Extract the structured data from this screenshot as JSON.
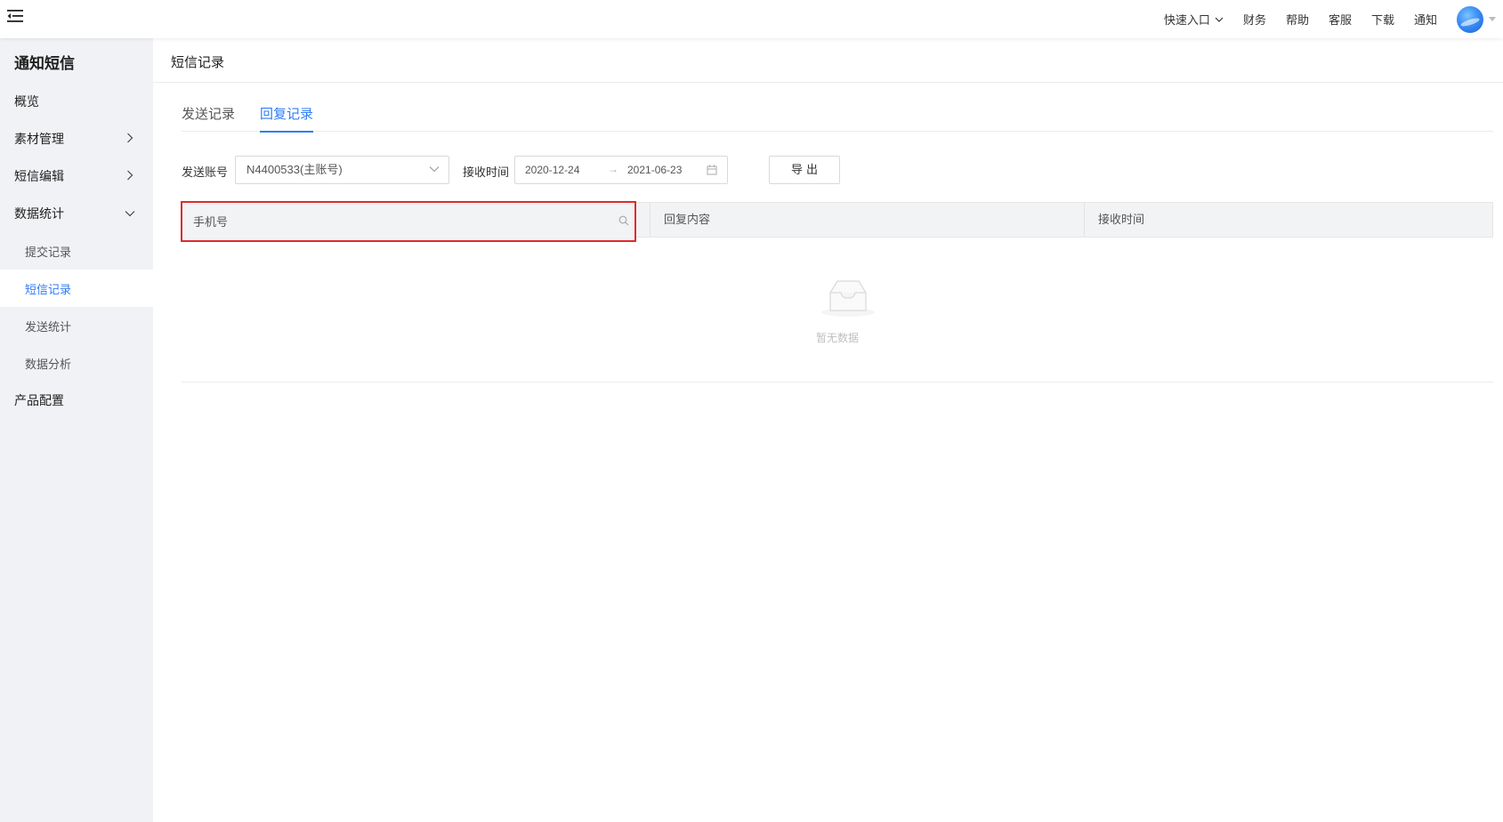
{
  "header": {
    "nav": [
      {
        "label": "快速入口",
        "has_dropdown": true
      },
      {
        "label": "财务"
      },
      {
        "label": "帮助"
      },
      {
        "label": "客服"
      },
      {
        "label": "下载"
      },
      {
        "label": "通知"
      }
    ]
  },
  "sidebar": {
    "title": "通知短信",
    "items": [
      {
        "label": "概览"
      },
      {
        "label": "素材管理",
        "arrow": "right"
      },
      {
        "label": "短信编辑",
        "arrow": "right"
      },
      {
        "label": "数据统计",
        "arrow": "down",
        "expanded": true,
        "children": [
          {
            "label": "提交记录"
          },
          {
            "label": "短信记录",
            "active": true
          },
          {
            "label": "发送统计"
          },
          {
            "label": "数据分析"
          }
        ]
      },
      {
        "label": "产品配置"
      }
    ]
  },
  "main": {
    "page_title": "短信记录",
    "tabs": [
      {
        "label": "发送记录"
      },
      {
        "label": "回复记录",
        "active": true
      }
    ],
    "filters": {
      "account_label": "发送账号",
      "account_value": "N4400533(主账号)",
      "time_label": "接收时间",
      "date_start": "2020-12-24",
      "date_sep": "→",
      "date_end": "2021-06-23",
      "export_label": "导出"
    },
    "table": {
      "phone_placeholder": "手机号",
      "columns": [
        "回复内容",
        "接收时间"
      ],
      "empty_text": "暂无数据"
    }
  },
  "colors": {
    "accent": "#2f7cf6",
    "highlight_border": "#e02b2b",
    "sidebar_bg": "#f0f2f5"
  }
}
